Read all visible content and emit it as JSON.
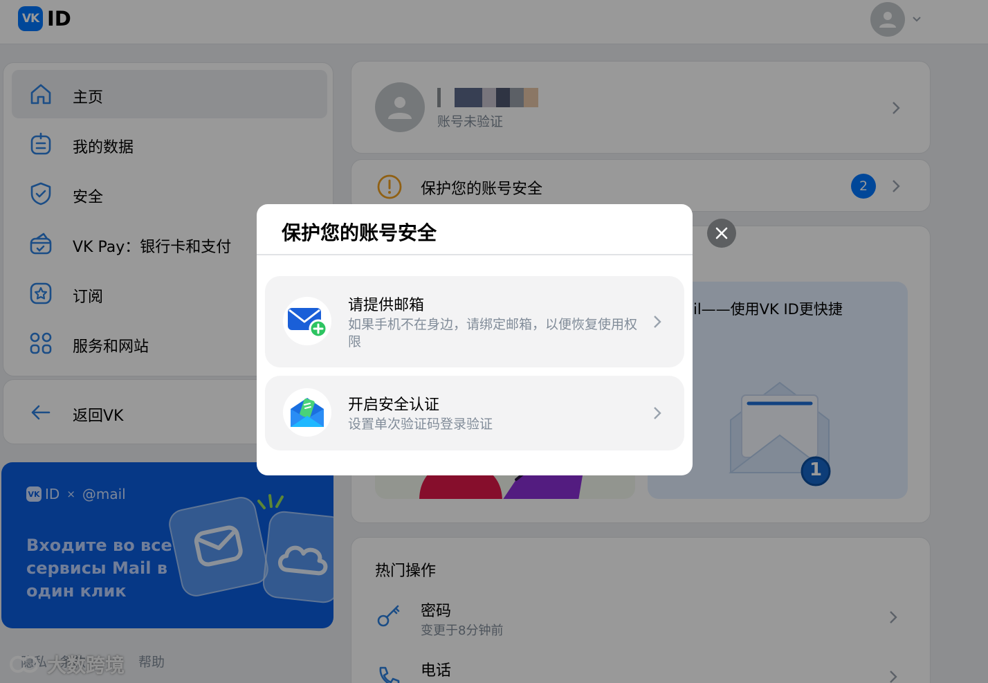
{
  "header": {
    "logo_mark": "VK",
    "logo_text": "ID"
  },
  "sidebar": {
    "items": [
      {
        "label": "主页",
        "icon": "home-icon",
        "active": true
      },
      {
        "label": "我的数据",
        "icon": "personal-data-icon"
      },
      {
        "label": "安全",
        "icon": "shield-icon"
      },
      {
        "label": "VK Pay：银行卡和支付",
        "icon": "wallet-icon"
      },
      {
        "label": "订阅",
        "icon": "star-icon"
      },
      {
        "label": "服务和网站",
        "icon": "services-grid-icon"
      }
    ],
    "back": {
      "label": "返回VK",
      "icon": "arrow-left-icon"
    }
  },
  "promo": {
    "brand_id": "ID",
    "brand_x": "×",
    "brand_mail": "@mail",
    "text": "Входите во все сервисы Mail в один клик"
  },
  "footer": {
    "links": [
      "隐私",
      "条款",
      "帮助"
    ],
    "watermark": "大数跨境"
  },
  "profile": {
    "status": "账号未验证"
  },
  "security": {
    "label": "保护您的账号安全",
    "count": "2"
  },
  "feature": {
    "right_title": "录Mail——使用VK ID更快捷",
    "right_badge": "1"
  },
  "popular": {
    "title": "热门操作",
    "items": [
      {
        "title": "密码",
        "subtitle": "变更于8分钟前",
        "icon": "key-icon"
      },
      {
        "title": "电话",
        "subtitle": "",
        "icon": "phone-icon"
      }
    ]
  },
  "modal": {
    "title": "保护您的账号安全",
    "options": [
      {
        "title": "请提供邮箱",
        "desc": "如果手机不在身边，请绑定邮箱，以便恢复使用权限",
        "icon": "email-add-icon"
      },
      {
        "title": "开启安全认证",
        "desc": "设置单次验证码登录验证",
        "icon": "two-factor-mail-icon"
      }
    ]
  },
  "colors": {
    "accent": "#0077ff",
    "warning": "#f0a020",
    "secondary_text": "#818c99",
    "promo_bg": "#0a5ee0"
  }
}
